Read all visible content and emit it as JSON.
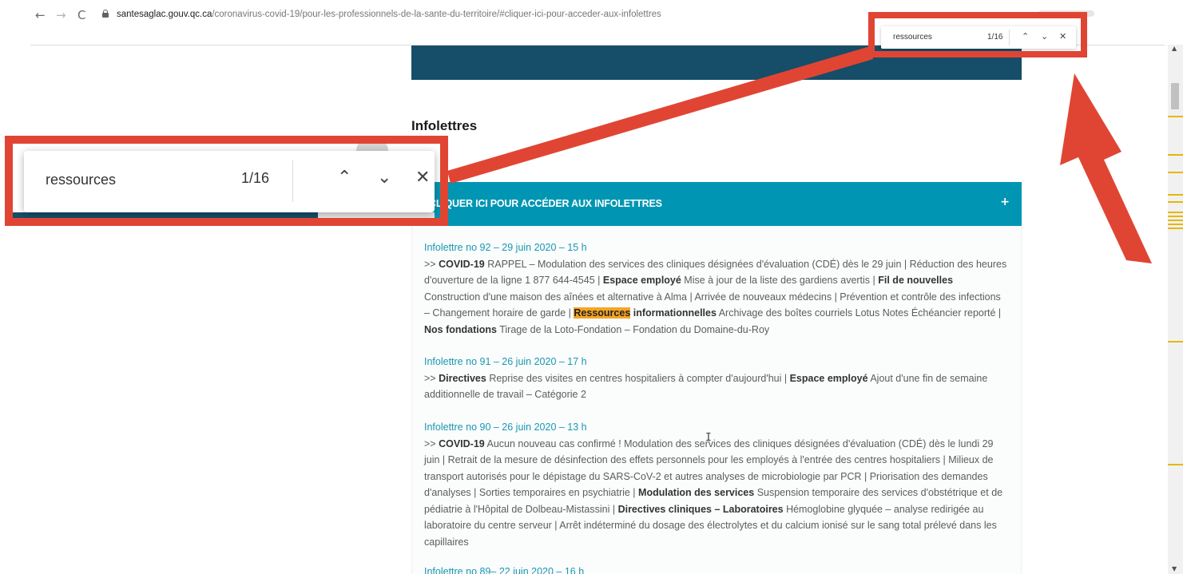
{
  "browser": {
    "url_host": "santesaglac.gouv.qc.ca",
    "url_path": "/coronavirus-covid-19/pour-les-professionnels-de-la-sante-du-territoire/#cliquer-ici-pour-acceder-aux-infolettres",
    "back_icon": "←",
    "forward_icon": "→",
    "reload_icon": "C"
  },
  "find_bar": {
    "query": "ressources",
    "count": "1/16",
    "prev_icon": "⌃",
    "next_icon": "⌄",
    "close_icon": "✕"
  },
  "page": {
    "section_title": "Infolettres",
    "accordion_label": "CLIQUER ICI POUR ACCÉDER AUX INFOLETTRES",
    "accordion_toggle": "+",
    "entries": [
      {
        "title": "Infolettre no 92 – 29 juin 2020 – 15 h",
        "p0": ">> ",
        "b0": "COVID-19",
        "p1": " RAPPEL – Modulation des services des cliniques désignées d'évaluation (CDÉ) dès le 29 juin | Réduction des heures d'ouverture de la ligne 1 877 644-4545 | ",
        "b1": "Espace employé",
        "p2": " Mise à jour de la liste des gardiens avertis | ",
        "b2": "Fil de nouvelles",
        "p3": " Construction d'une maison des aînées et alternative à Alma | Arrivée de nouveaux médecins | Prévention et contrôle des infections – Changement horaire de garde | ",
        "highlight": "Ressources",
        "b3": " informationnelles",
        "p4": " Archivage des boîtes courriels Lotus Notes Échéancier reporté | ",
        "b4": "Nos fondations",
        "p5": " Tirage de la Loto-Fondation – Fondation du Domaine-du-Roy"
      },
      {
        "title": "Infolettre no 91 – 26 juin 2020 – 17 h",
        "p0": ">> ",
        "b0": "Directives",
        "p1": " Reprise des visites en centres hospitaliers à compter d'aujourd'hui | ",
        "b1": "Espace employé",
        "p2": " Ajout d'une fin de semaine additionnelle de travail – Catégorie 2"
      },
      {
        "title": "Infolettre no 90 – 26 juin 2020 – 13 h",
        "p0": ">> ",
        "b0": "COVID-19",
        "p1": " Aucun nouveau cas confirmé ! Modulation des services des cliniques désignées d'évaluation (CDÉ) dès le lundi 29 juin | Retrait de la mesure de désinfection des effets personnels pour les employés à l'entrée des centres hospitaliers | Milieux de transport autorisés pour le dépistage du SARS-CoV-2 et autres analyses de microbiologie par PCR | Priorisation des demandes d'analyses | Sorties temporaires en psychiatrie | ",
        "b1": "Modulation des services",
        "p2": " Suspension temporaire des services d'obstétrique et de pédiatrie à l'Hôpital de Dolbeau-Mistassini | ",
        "b2": "Directives cliniques – Laboratoires",
        "p3": " Hémoglobine glyquée – analyse redirigée au laboratoire du centre serveur | Arrêt indéterminé du dosage des électrolytes et du calcium ionisé sur le sang total prélevé dans les capillaires"
      },
      {
        "title": "Infolettre no 89– 22 juin 2020 – 16 h"
      }
    ]
  },
  "colors": {
    "annotation_red": "#e04534",
    "banner": "#164d68",
    "accordion": "#0096b3",
    "highlight": "#f5a524",
    "link": "#1998b3"
  }
}
